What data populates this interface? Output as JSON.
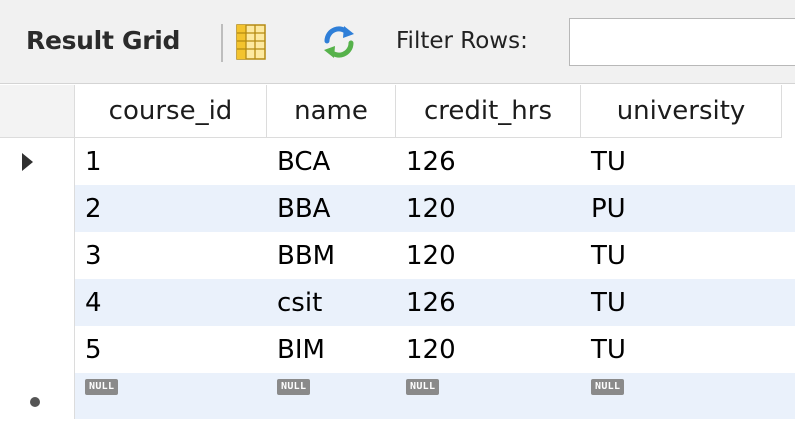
{
  "toolbar": {
    "result_grid_label": "Result Grid",
    "filter_label": "Filter Rows:",
    "filter_value": ""
  },
  "colors": {
    "stripe": "#eaf1fb",
    "grid_icon_yellow": "#f3c32e",
    "refresh_icon_blue": "#2f7fd8"
  },
  "icons": {
    "grid_toggle": "grid-toggle-icon",
    "refresh": "refresh-icon",
    "current_row": "current-row-caret-icon",
    "new_row": "new-row-icon"
  },
  "table": {
    "columns": [
      "course_id",
      "name",
      "credit_hrs",
      "university"
    ],
    "rows": [
      [
        "1",
        "BCA",
        "126",
        "TU"
      ],
      [
        "2",
        "BBA",
        "120",
        "PU"
      ],
      [
        "3",
        "BBM",
        "120",
        "TU"
      ],
      [
        "4",
        "csit",
        "126",
        "TU"
      ],
      [
        "5",
        "BIM",
        "120",
        "TU"
      ]
    ],
    "null_label": "NULL"
  }
}
